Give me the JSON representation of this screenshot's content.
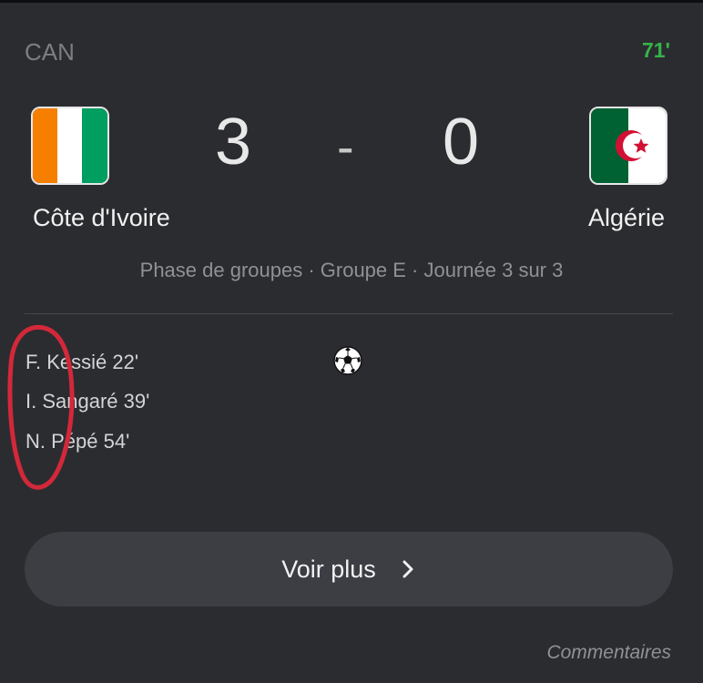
{
  "header": {
    "competition": "CAN",
    "minute": "71'"
  },
  "match": {
    "home_team": "Côte d'Ivoire",
    "away_team": "Algérie",
    "home_score": "3",
    "away_score": "0",
    "separator": "-",
    "phase": "Phase de groupes · Groupe E · Journée 3 sur 3"
  },
  "scorers": [
    {
      "text": "F. Kessié 22'"
    },
    {
      "text": "I. Sangaré 39'"
    },
    {
      "text": "N. Pépé 54'"
    }
  ],
  "actions": {
    "more_label": "Voir plus",
    "comments_label": "Commentaires"
  },
  "icons": {
    "home_flag": "flag-cote-divoire-icon",
    "away_flag": "flag-algeria-icon",
    "goal": "soccer-ball-icon",
    "more": "chevron-right-icon"
  },
  "colors": {
    "live_minute": "#35b34a",
    "card_background": "#2b2c30",
    "annotation": "#d3283a"
  }
}
